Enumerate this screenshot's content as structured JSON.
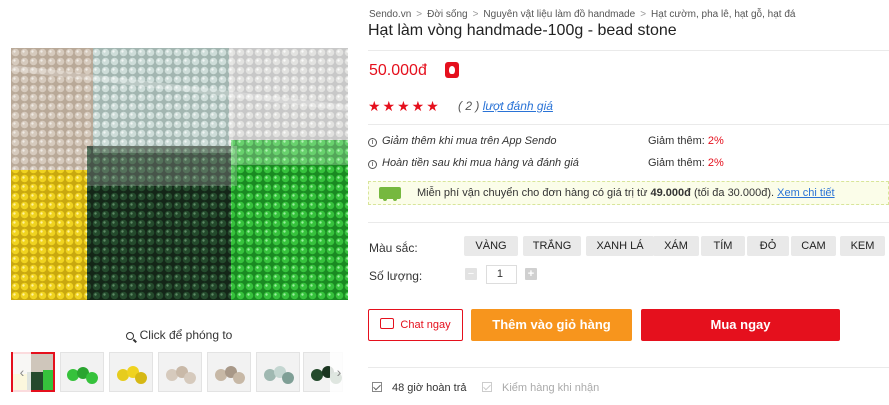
{
  "breadcrumb": [
    "Sendo.vn",
    "Đời sống",
    "Nguyên vật liệu làm đồ handmade",
    "Hạt cườm, pha lê, hạt gỗ, hạt đá"
  ],
  "breadcrumb_separator": ">",
  "product": {
    "title": "Hạt làm vòng handmade-100g - bead stone",
    "price": "50.000đ",
    "stars": "★★★★★",
    "rating_count": "( 2 )",
    "rating_link": "lượt đánh giá"
  },
  "promotions": [
    {
      "text": "Giảm thêm khi mua trên App Sendo",
      "extra_label": "Giảm thêm:",
      "extra_value": "2%"
    },
    {
      "text": "Hoàn tiền sau khi mua hàng và đánh giá",
      "extra_label": "Giảm thêm:",
      "extra_value": "2%"
    }
  ],
  "shipping": {
    "text_before": "Miễn phí vận chuyển cho đơn hàng có giá trị từ",
    "threshold": "49.000đ",
    "text_after": "(tối đa 30.000đ).",
    "link": "Xem chi tiết"
  },
  "options": {
    "color_label": "Màu sắc:",
    "colors": [
      "VÀNG",
      "TRẮNG",
      "XANH LÁ",
      "XÁM",
      "TÍM",
      "ĐỎ",
      "CAM",
      "KEM"
    ],
    "quantity_label": "Số lượng:",
    "quantity_value": "1",
    "minus": "−",
    "plus": "+"
  },
  "actions": {
    "chat": "Chat ngay",
    "add_to_cart": "Thêm vào giỏ hàng",
    "buy_now": "Mua ngay"
  },
  "guarantees": [
    "48 giờ hoàn trả",
    "Kiểm hàng khi nhận"
  ],
  "gallery": {
    "zoom_hint": "Click để phóng to",
    "prev": "‹",
    "next": "›"
  },
  "colors": {
    "primary_red": "#e5101d",
    "orange": "#f7951d",
    "link_blue": "#2a73d6"
  }
}
